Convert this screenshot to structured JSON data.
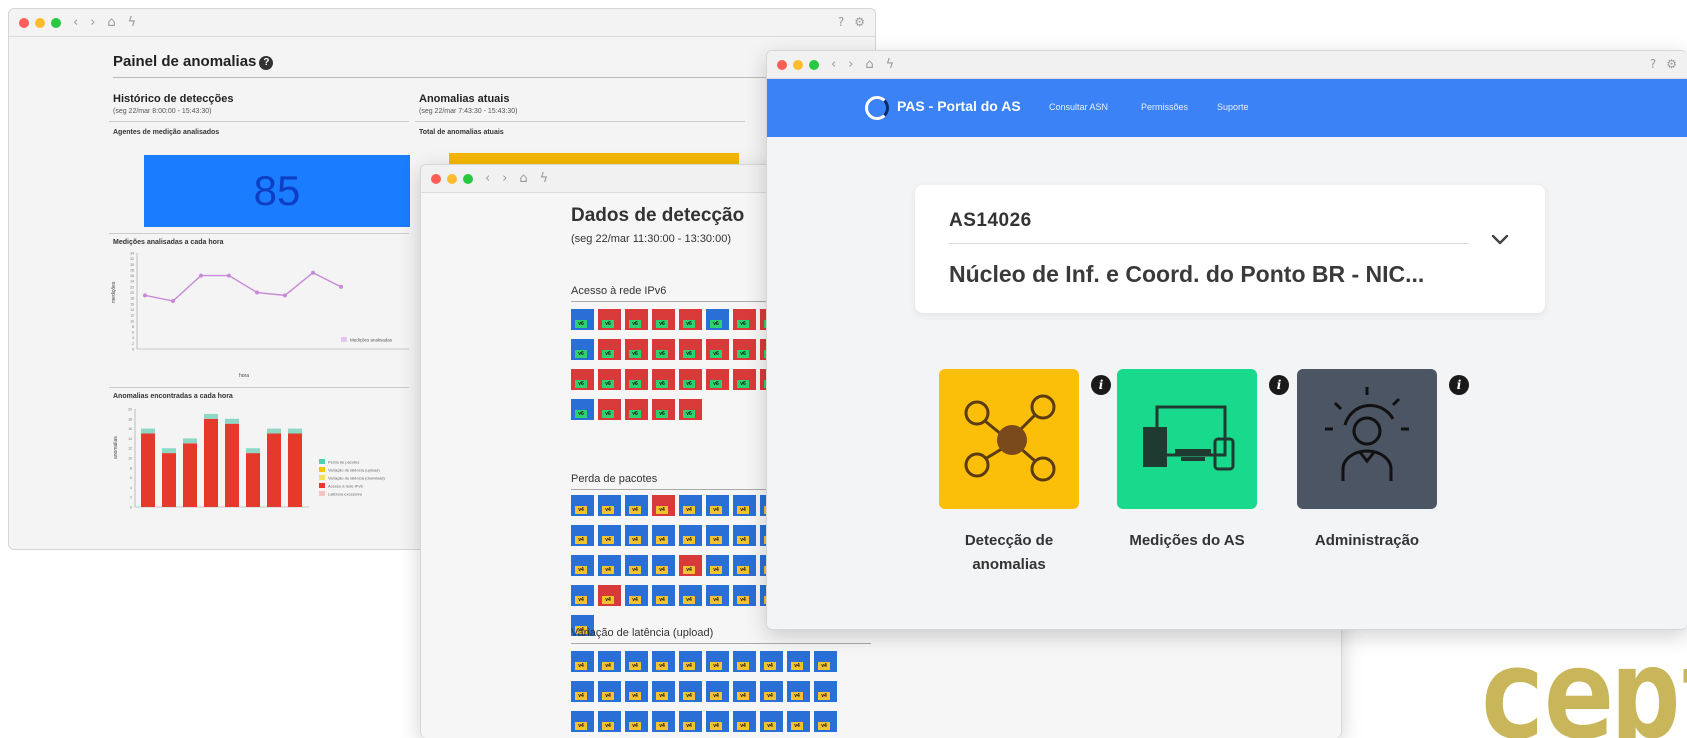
{
  "window_left": {
    "title": "Painel de anomalias",
    "history": {
      "heading": "Histórico de detecções",
      "range": "(seg 22/mar 8:00:00 - 15:43:30)",
      "agents_label": "Agentes de medição analisados",
      "agents_value": "85",
      "hourly_label": "Medições analisadas a cada hora",
      "hourly_x_label": "hora",
      "hourly_y_label": "medições",
      "hourly_legend": "Medições analisadas",
      "anomalies_label": "Anomalias encontradas a cada hora",
      "anomalies_y_label": "anomalias",
      "legend": [
        "Perda de pacotes",
        "Variação de latência (upload)",
        "Variação de latência (download)",
        "Acesso à rede IPv6",
        "Latência excessiva"
      ]
    },
    "current": {
      "heading": "Anomalias atuais",
      "range": "(seg 22/mar 7:43:30 - 15:43:30)",
      "total_label": "Total de anomalias atuais"
    }
  },
  "window_middle": {
    "title": "Dados de detecção",
    "range": "(seg 22/mar 11:30:00 - 13:30:00)",
    "sections": {
      "ipv6": "Acesso à rede IPv6",
      "loss": "Perda de pacotes",
      "latency_up": "Variação de latência (upload)"
    },
    "tags": {
      "v6": "v6",
      "v4": "v4"
    }
  },
  "window_right": {
    "brand": "PAS - Portal do AS",
    "nav": [
      "Consultar ASN",
      "Permissões",
      "Suporte"
    ],
    "as_selector": {
      "code": "AS14026",
      "name": "Núcleo de Inf. e Coord. do Ponto BR - NIC..."
    },
    "tiles": [
      {
        "label_line1": "Detecção de",
        "label_line2": "anomalias",
        "color": "#fbbf0a"
      },
      {
        "label_line1": "Medições do AS",
        "label_line2": "",
        "color": "#19d98c"
      },
      {
        "label_line1": "Administração",
        "label_line2": "",
        "color": "#4b5563"
      }
    ],
    "info_glyph": "i"
  },
  "logo_text": "ceptr",
  "chart_data": [
    {
      "type": "line",
      "title": "Medições analisadas a cada hora",
      "xlabel": "hora",
      "ylabel": "medições",
      "ylim": [
        0,
        34
      ],
      "series": [
        {
          "name": "Medições analisadas",
          "values": [
            19,
            17,
            26,
            26,
            20,
            19,
            27,
            22
          ]
        }
      ]
    },
    {
      "type": "bar",
      "title": "Anomalias encontradas a cada hora",
      "ylabel": "anomalias",
      "ylim": [
        0,
        20
      ],
      "series": [
        {
          "name": "Acesso à rede IPv6",
          "values": [
            15,
            11,
            13,
            18,
            17,
            11,
            15,
            15
          ]
        },
        {
          "name": "Perda de pacotes",
          "values": [
            1,
            1,
            1,
            1,
            1,
            1,
            1,
            1
          ]
        }
      ]
    }
  ]
}
